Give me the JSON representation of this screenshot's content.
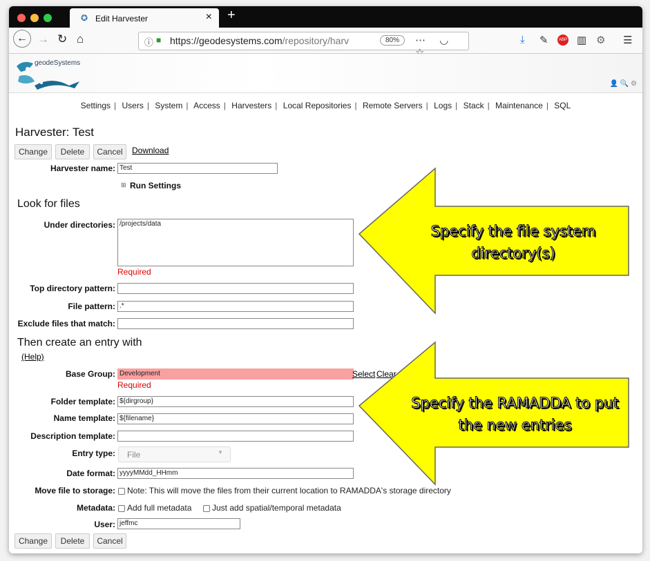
{
  "browser": {
    "tab_title": "Edit Harvester",
    "url_main": "https://geodesystems.com",
    "url_rest": "/repository/harv",
    "zoom": "80%"
  },
  "site": {
    "logo_text": "geodeSystems",
    "nav": [
      "Settings",
      "Users",
      "System",
      "Access",
      "Harvesters",
      "Local Repositories",
      "Remote Servers",
      "Logs",
      "Stack",
      "Maintenance",
      "SQL"
    ]
  },
  "page": {
    "title": "Harvester: Test",
    "buttons": {
      "change": "Change",
      "delete": "Delete",
      "cancel": "Cancel",
      "download": "Download"
    },
    "harvester_name_label": "Harvester name:",
    "harvester_name_value": "Test",
    "run_settings": "Run Settings",
    "look_for_files": "Look for files",
    "under_dirs_label": "Under directories:",
    "under_dirs_value": "/projects/data",
    "required": "Required",
    "top_dir_label": "Top directory pattern:",
    "top_dir_value": "",
    "file_pattern_label": "File pattern:",
    "file_pattern_value": ".*",
    "exclude_label": "Exclude files that match:",
    "exclude_value": "",
    "then_create": "Then create an entry with",
    "help": "(Help)",
    "base_group_label": "Base Group:",
    "base_group_value": "Development",
    "select": "Select",
    "clear": "Clear",
    "folder_template_label": "Folder template:",
    "folder_template_value": "${dirgroup}",
    "name_template_label": "Name template:",
    "name_template_value": "${filename}",
    "desc_template_label": "Description template:",
    "desc_template_value": "",
    "entry_type_label": "Entry type:",
    "entry_type_value": "File",
    "date_format_label": "Date format:",
    "date_format_value": "yyyyMMdd_HHmm",
    "move_label": "Move file to storage:",
    "move_note": "Note: This will move the files from their current location to RAMADDA's storage directory",
    "metadata_label": "Metadata:",
    "metadata_full": "Add full metadata",
    "metadata_spatial": "Just add spatial/temporal metadata",
    "user_label": "User:",
    "user_value": "jeffmc"
  },
  "callouts": {
    "one": "Specify the file system directory(s)",
    "two": "Specify the RAMADDA to put the new entries",
    "color": "#ffff00"
  }
}
